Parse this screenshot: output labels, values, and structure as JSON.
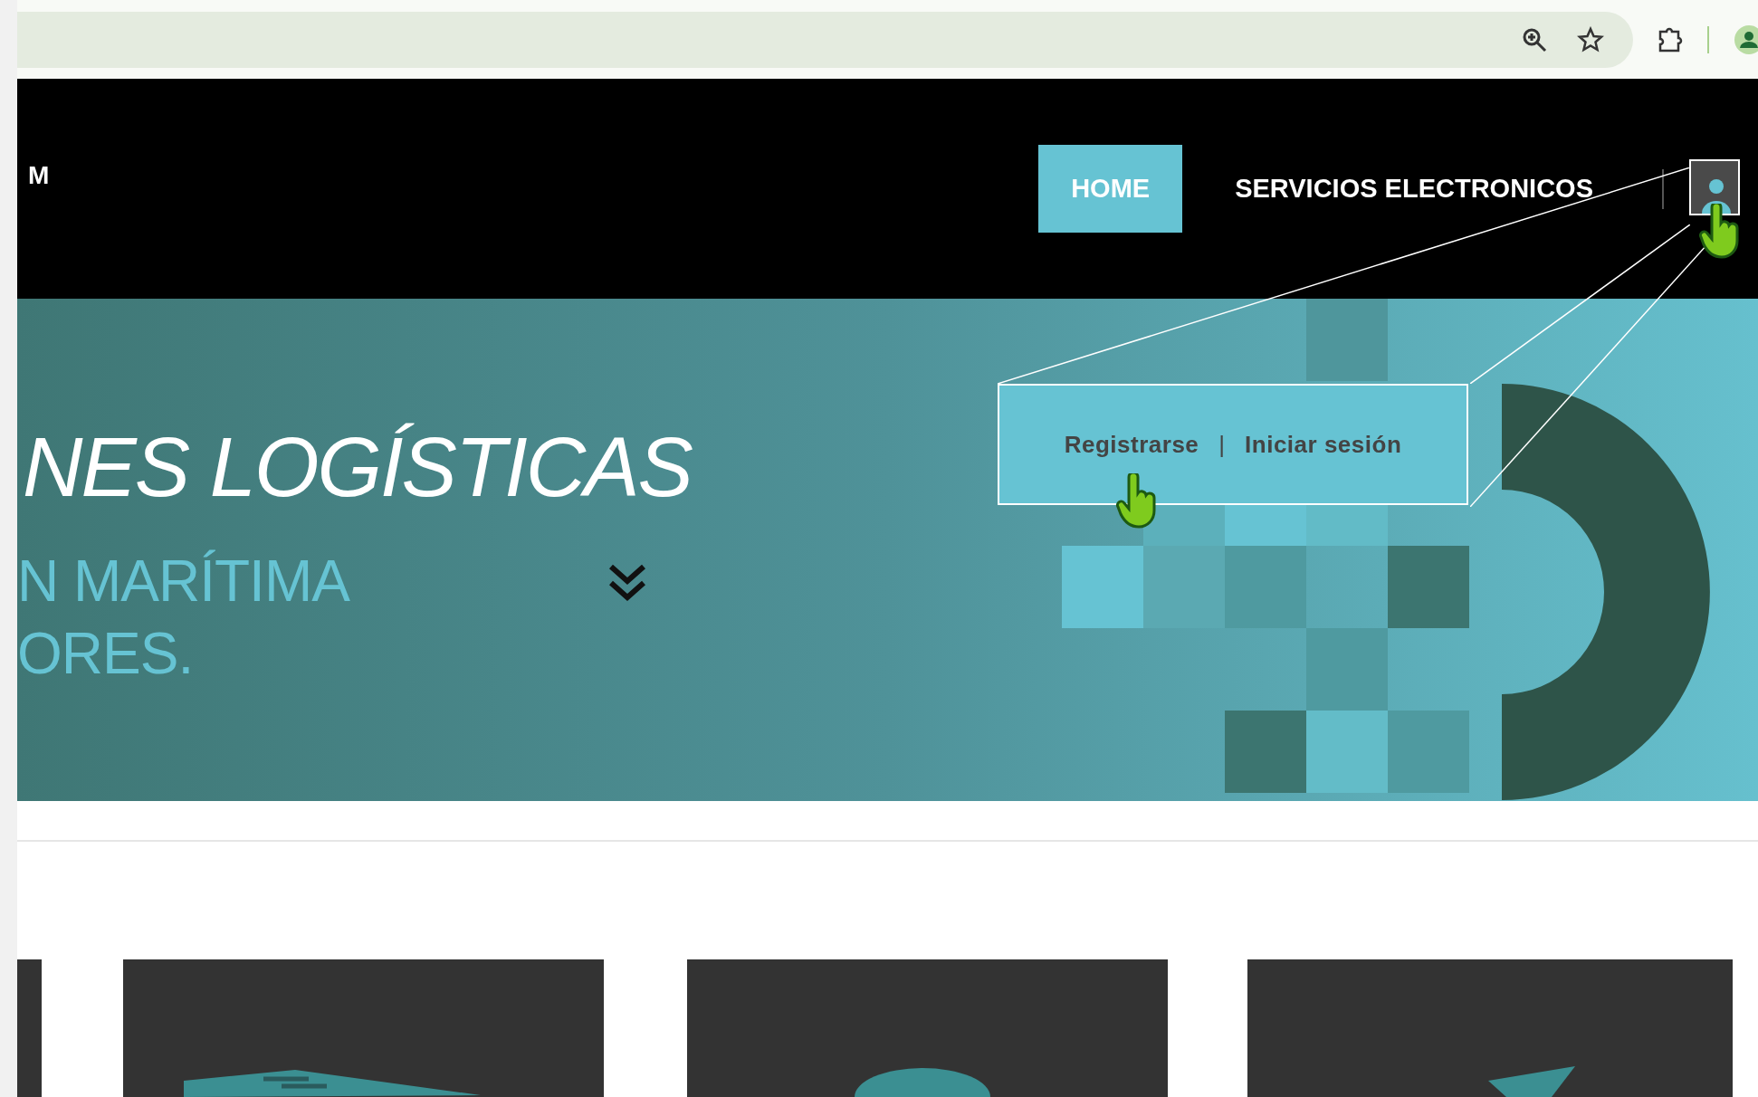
{
  "header": {
    "logo_text": "M",
    "nav": [
      {
        "label": "HOME",
        "selected": true
      },
      {
        "label": "SERVICIOS ELECTRONICOS",
        "selected": false
      }
    ]
  },
  "hero": {
    "title": "NES LOGÍSTICAS",
    "subtitle_lines": [
      "N MARÍTIMA",
      "ORES."
    ]
  },
  "user_popup": {
    "links": [
      "Registrarse",
      "Iniciar sesión"
    ],
    "separator": "|"
  }
}
